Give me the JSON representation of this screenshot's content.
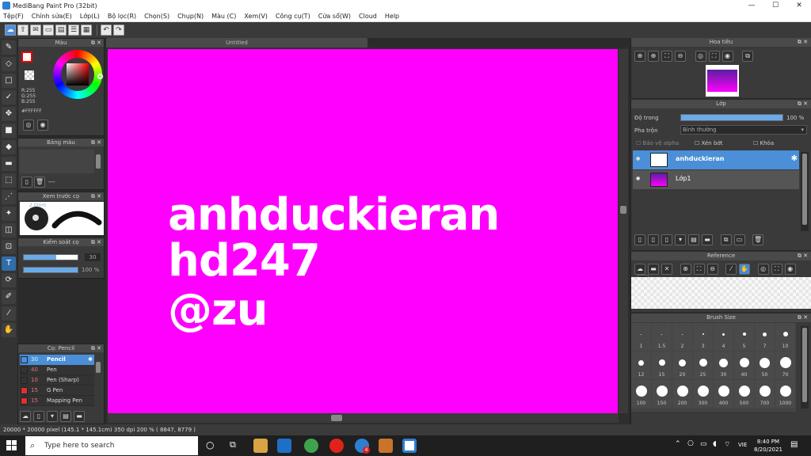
{
  "app": {
    "title": "MediBang Paint Pro (32bit)"
  },
  "window_controls": {
    "minimize": "—",
    "maximize": "☐",
    "close": "✕"
  },
  "menu": [
    "Tệp(F)",
    "Chỉnh sửa(E)",
    "Lớp(L)",
    "Bộ lọc(R)",
    "Chọn(S)",
    "Chụp(N)",
    "Màu (C)",
    "Xem(V)",
    "Công cụ(T)",
    "Cửa sổ(W)",
    "Cloud",
    "Help"
  ],
  "document": {
    "tab": "Untitled",
    "canvas_color": "#ff00ff",
    "lines": [
      "anhduckieran",
      "hd247",
      "@zu"
    ]
  },
  "color_panel": {
    "title": "Màu",
    "r": "R:255",
    "g": "G:255",
    "b": "B:255",
    "hex": "#FFFFFF"
  },
  "palette_panel": {
    "title": "Bảng màu",
    "dash": "---"
  },
  "brush_preview": {
    "title": "Xem trước cọ",
    "size": "2.0mm"
  },
  "brush_control": {
    "title": "Kiểm soát cọ",
    "size": "30",
    "opacity": "100 %"
  },
  "brush_list": {
    "title": "Cọ: Pencil",
    "items": [
      {
        "size": "30",
        "name": "Pencil",
        "color": "#4a90e2",
        "selected": true
      },
      {
        "size": "40",
        "name": "Pen",
        "color": "#333333",
        "selected": false
      },
      {
        "size": "10",
        "name": "Pen (Sharp)",
        "color": "#333333",
        "selected": false
      },
      {
        "size": "15",
        "name": "G Pen",
        "color": "#e03030",
        "selected": false
      },
      {
        "size": "15",
        "name": "Mapping Pen",
        "color": "#e03030",
        "selected": false
      }
    ]
  },
  "navigator": {
    "title": "Hoa tiêu"
  },
  "layer_panel": {
    "title": "Lớp",
    "opacity_label": "Độ trong",
    "opacity_value": "100 %",
    "blend_label": "Pha trộn",
    "blend_value": "Bình thường",
    "protect_alpha": "Bảo vệ alpha",
    "clipping": "Xén bớt",
    "lock": "Khóa",
    "layers": [
      {
        "name": "anhduckieran",
        "selected": true
      },
      {
        "name": "Lớp1",
        "selected": false
      }
    ]
  },
  "reference_panel": {
    "title": "Reference"
  },
  "brush_size_panel": {
    "title": "Brush Size",
    "rows": [
      [
        "1",
        "1.5",
        "2",
        "3",
        "4",
        "5",
        "7",
        "10"
      ],
      [
        "12",
        "15",
        "20",
        "25",
        "30",
        "40",
        "50",
        "70"
      ],
      [
        "100",
        "150",
        "200",
        "300",
        "400",
        "500",
        "700",
        "1000"
      ]
    ]
  },
  "status": {
    "text": "20000 * 20000 pixel  (145.1 * 145.1cm)  350 dpi  200 %  ( 8847, 8779 )"
  },
  "taskbar": {
    "search_placeholder": "Type here to search",
    "language": "VIE",
    "time": "8:40 PM",
    "date": "8/20/2021",
    "badge": "4"
  }
}
